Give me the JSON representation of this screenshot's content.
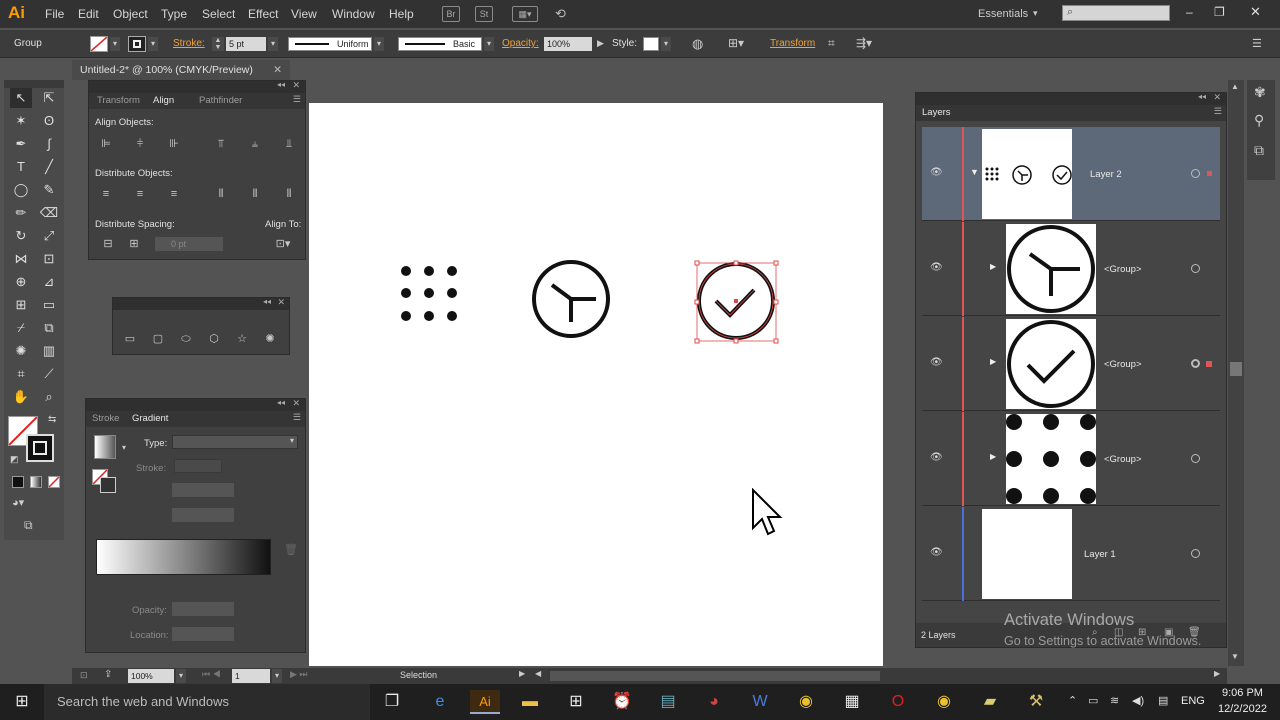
{
  "app": {
    "logo": "Ai",
    "menu": [
      "File",
      "Edit",
      "Object",
      "Type",
      "Select",
      "Effect",
      "View",
      "Window",
      "Help"
    ],
    "workspace": "Essentials",
    "window_buttons": [
      "–",
      "❐",
      "✕"
    ]
  },
  "control": {
    "selection_type": "Group",
    "stroke_label": "Stroke:",
    "stroke_value": "5 pt",
    "profile": "Uniform",
    "brush": "Basic",
    "opacity_label": "Opacity:",
    "opacity_value": "100%",
    "style_label": "Style:",
    "transform_label": "Transform"
  },
  "document": {
    "tab_title": "Untitled-2* @ 100% (CMYK/Preview)",
    "zoom": "100%",
    "artboard_number": "1",
    "status_tool": "Selection"
  },
  "align_panel": {
    "tabs": [
      "Transform",
      "Align",
      "Pathfinder"
    ],
    "align_objects": "Align Objects:",
    "distribute_objects": "Distribute Objects:",
    "distribute_spacing": "Distribute Spacing:",
    "align_to": "Align To:",
    "spacing_value": "0 pt"
  },
  "gradient_panel": {
    "tabs": [
      "Stroke",
      "Gradient"
    ],
    "type_label": "Type:",
    "stroke_label": "Stroke:",
    "opacity_label": "Opacity:",
    "location_label": "Location:"
  },
  "layers_panel": {
    "title": "Layers",
    "rows": [
      {
        "name": "Layer 2"
      },
      {
        "name": "<Group>"
      },
      {
        "name": "<Group>"
      },
      {
        "name": "<Group>"
      },
      {
        "name": "Layer 1"
      }
    ],
    "footer": "2 Layers",
    "colors": {
      "layer2": "#e05555",
      "layer1": "#4c6fe0"
    }
  },
  "watermark": {
    "line1": "Activate Windows",
    "line2": "Go to Settings to activate Windows."
  },
  "taskbar": {
    "search_placeholder": "Search the web and Windows",
    "language": "ENG",
    "time": "9:06 PM",
    "date": "12/2/2022"
  },
  "colors": {
    "accent_orange": "#f0a23c",
    "selection_red": "#e04848"
  }
}
